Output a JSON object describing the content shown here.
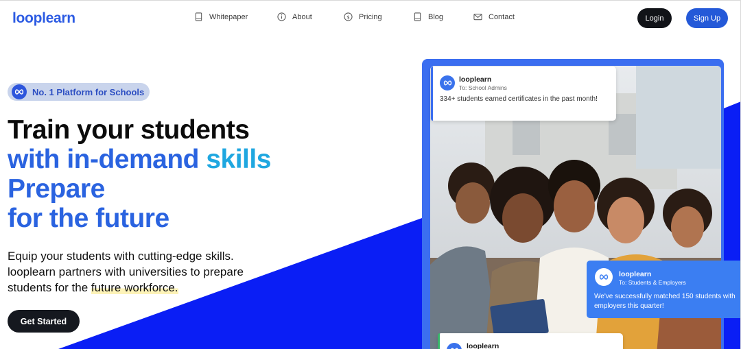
{
  "brand": {
    "logo_text": "looplearn",
    "accent": "#2459d8",
    "secondary": "#1fa7e0"
  },
  "nav": {
    "items": [
      {
        "label": "Whitepaper",
        "icon": "document-icon"
      },
      {
        "label": "About",
        "icon": "info-icon"
      },
      {
        "label": "Pricing",
        "icon": "dollar-icon"
      },
      {
        "label": "Blog",
        "icon": "book-icon"
      },
      {
        "label": "Contact",
        "icon": "mail-icon"
      }
    ],
    "login_label": "Login",
    "signup_label": "Sign Up"
  },
  "hero": {
    "badge": "No. 1 Platform for Schools",
    "headline_line1": "Train your students",
    "headline_line2_a": "with in-demand ",
    "headline_line2_b": "skills",
    "headline_line3": "Prepare",
    "headline_line4": "for the future",
    "paragraph_a": "Equip your students with cutting-edge skills. looplearn partners with universities to prepare students for the ",
    "paragraph_highlight": "future workforce.",
    "cta_label": "Get Started"
  },
  "notifications": [
    {
      "name": "looplearn",
      "to": "To: School Admins",
      "message": "334+ students earned certificates in the past month!"
    },
    {
      "name": "looplearn",
      "to": "To: Students & Employers",
      "message": "We've successfully matched 150 students with employers this quarter!"
    },
    {
      "name": "looplearn"
    }
  ]
}
